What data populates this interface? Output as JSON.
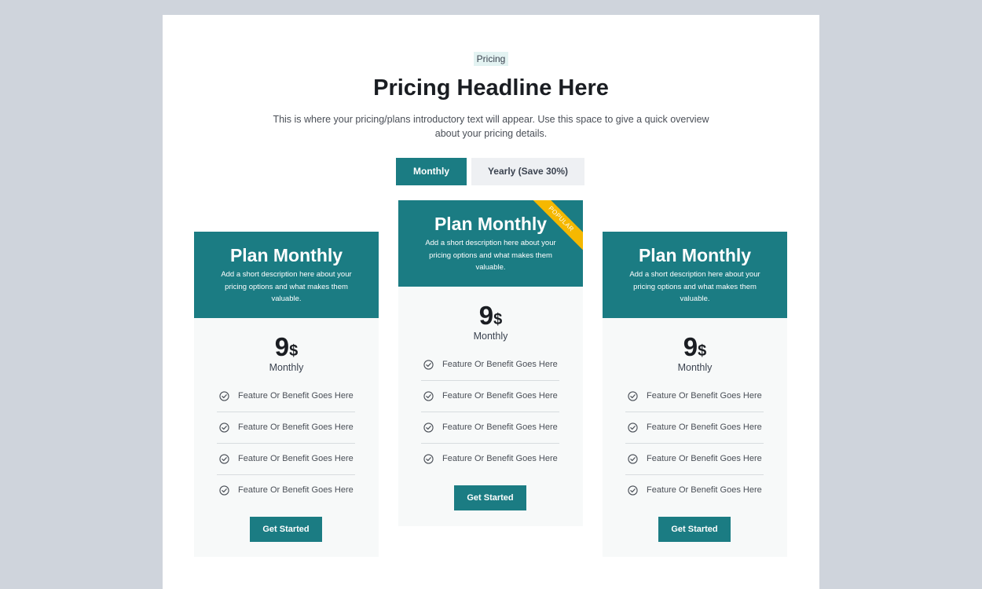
{
  "section": {
    "eyebrow": "Pricing",
    "headline": "Pricing Headline Here",
    "intro": "This is where your pricing/plans introductory text will appear. Use this space to give a quick overview about your pricing details."
  },
  "billing_toggle": {
    "monthly_label": "Monthly",
    "yearly_label": "Yearly (Save 30%)",
    "selected": "Monthly"
  },
  "plans": [
    {
      "title": "Plan Monthly",
      "description": "Add a short description here about your pricing options and what makes them valuable.",
      "price": "9",
      "currency": "$",
      "period": "Monthly",
      "features": [
        "Feature Or Benefit Goes Here",
        "Feature Or Benefit Goes Here",
        "Feature Or Benefit Goes Here",
        "Feature Or Benefit Goes Here"
      ],
      "cta_label": "Get Started"
    },
    {
      "title": "Plan Monthly",
      "description": "Add a short description here about your pricing options and what makes them valuable.",
      "price": "9",
      "currency": "$",
      "period": "Monthly",
      "badge": "POPULAR",
      "features": [
        "Feature Or Benefit Goes Here",
        "Feature Or Benefit Goes Here",
        "Feature Or Benefit Goes Here",
        "Feature Or Benefit Goes Here"
      ],
      "cta_label": "Get Started"
    },
    {
      "title": "Plan Monthly",
      "description": "Add a short description here about your pricing options and what makes them valuable.",
      "price": "9",
      "currency": "$",
      "period": "Monthly",
      "features": [
        "Feature Or Benefit Goes Here",
        "Feature Or Benefit Goes Here",
        "Feature Or Benefit Goes Here",
        "Feature Or Benefit Goes Here"
      ],
      "cta_label": "Get Started"
    }
  ],
  "icons": {
    "feature_check": "check-circle-icon"
  },
  "colors": {
    "accent": "#1b7c83",
    "badge": "#f5b800",
    "page_background": "#cfd4dc",
    "card_background": "#f7f9f9",
    "toggle_inactive": "#eef0f3"
  }
}
